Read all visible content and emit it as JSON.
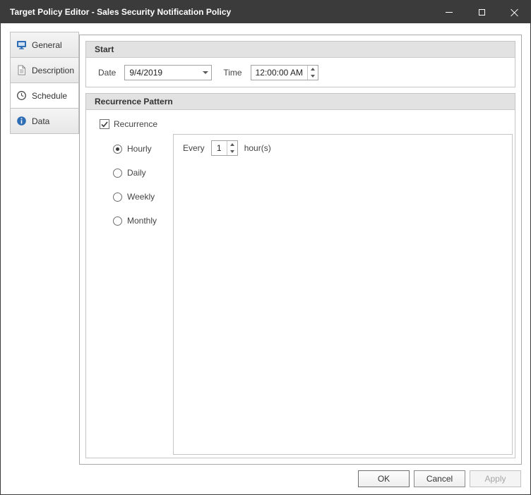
{
  "window": {
    "title": "Target Policy Editor - Sales Security Notification Policy"
  },
  "titlebar_controls": {
    "minimize": "minimize-icon",
    "maximize": "maximize-icon",
    "close": "close-icon"
  },
  "sidebar": {
    "tabs": [
      {
        "label": "General",
        "icon": "monitor-icon",
        "selected": false
      },
      {
        "label": "Description",
        "icon": "document-icon",
        "selected": false
      },
      {
        "label": "Schedule",
        "icon": "clock-icon",
        "selected": true
      },
      {
        "label": "Data",
        "icon": "info-icon",
        "selected": false
      }
    ]
  },
  "start_section": {
    "title": "Start",
    "date_label": "Date",
    "date_value": "9/4/2019",
    "time_label": "Time",
    "time_value": "12:00:00 AM"
  },
  "recurrence_section": {
    "title": "Recurrence Pattern",
    "checkbox_label": "Recurrence",
    "checkbox_checked": true,
    "options": [
      {
        "label": "Hourly",
        "selected": true
      },
      {
        "label": "Daily",
        "selected": false
      },
      {
        "label": "Weekly",
        "selected": false
      },
      {
        "label": "Monthly",
        "selected": false
      }
    ],
    "hourly_panel": {
      "every_label": "Every",
      "interval_value": "1",
      "unit_label": "hour(s)"
    }
  },
  "footer": {
    "ok_label": "OK",
    "cancel_label": "Cancel",
    "apply_label": "Apply",
    "apply_enabled": false
  },
  "colors": {
    "titlebar_bg": "#3b3b3b",
    "section_header_bg": "#e2e2e2",
    "accent_blue": "#2e6db4"
  }
}
